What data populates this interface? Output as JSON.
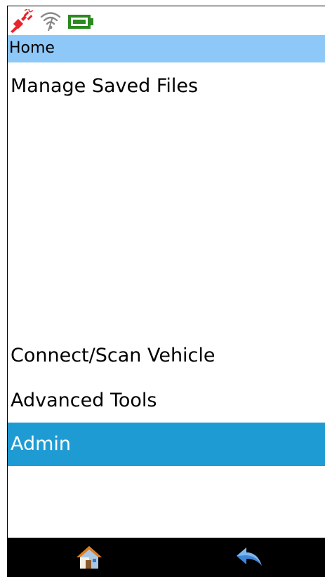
{
  "status_bar": {
    "icons": [
      "plug-disconnected-icon",
      "wifi-off-icon",
      "battery-icon"
    ],
    "colors": {
      "plug": "#e8242c",
      "wifi": "#888888",
      "battery": "#2a8a1e"
    }
  },
  "header": {
    "title": "Home",
    "background": "#8ec8f8"
  },
  "menu": {
    "items": [
      {
        "label": "Manage Saved Files",
        "selected": false
      },
      {
        "label": "Connect/Scan Vehicle",
        "selected": false
      },
      {
        "label": "Advanced Tools",
        "selected": false
      },
      {
        "label": "Admin",
        "selected": true
      }
    ],
    "selected_color": "#1f9bd3"
  },
  "bottom_bar": {
    "buttons": [
      "home-icon",
      "back-arrow-icon"
    ],
    "background": "#000000"
  }
}
